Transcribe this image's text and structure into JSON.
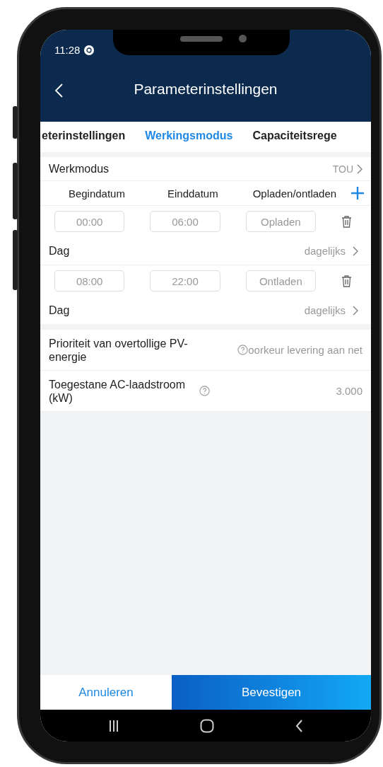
{
  "status_bar": {
    "time": "11:28"
  },
  "header": {
    "title": "Parameterinstellingen"
  },
  "tabs": [
    {
      "label": "eterinstellingen",
      "selected": false
    },
    {
      "label": "Werkingsmodus",
      "selected": true
    },
    {
      "label": "Capaciteitsrege",
      "selected": false
    }
  ],
  "work_mode": {
    "label": "Werkmodus",
    "value": "TOU"
  },
  "schedule": {
    "columns": [
      "Begindatum",
      "Einddatum",
      "Opladen/ontladen"
    ],
    "periods": [
      {
        "start": "00:00",
        "end": "06:00",
        "mode": "Opladen",
        "repeat_label": "Dag",
        "repeat_value": "dagelijks"
      },
      {
        "start": "08:00",
        "end": "22:00",
        "mode": "Ontladen",
        "repeat_label": "Dag",
        "repeat_value": "dagelijks"
      }
    ]
  },
  "settings": [
    {
      "kind": "option",
      "label": "Prioriteit van overtollige PV-energie",
      "value": "oorkeur levering aan net"
    },
    {
      "kind": "input",
      "label": "Toegestane AC-laadstroom (kW)",
      "value": "3.000"
    }
  ],
  "buttons": [
    {
      "kind": "secondary",
      "label": "Annuleren"
    },
    {
      "kind": "primary",
      "label": "Bevestigen"
    }
  ]
}
